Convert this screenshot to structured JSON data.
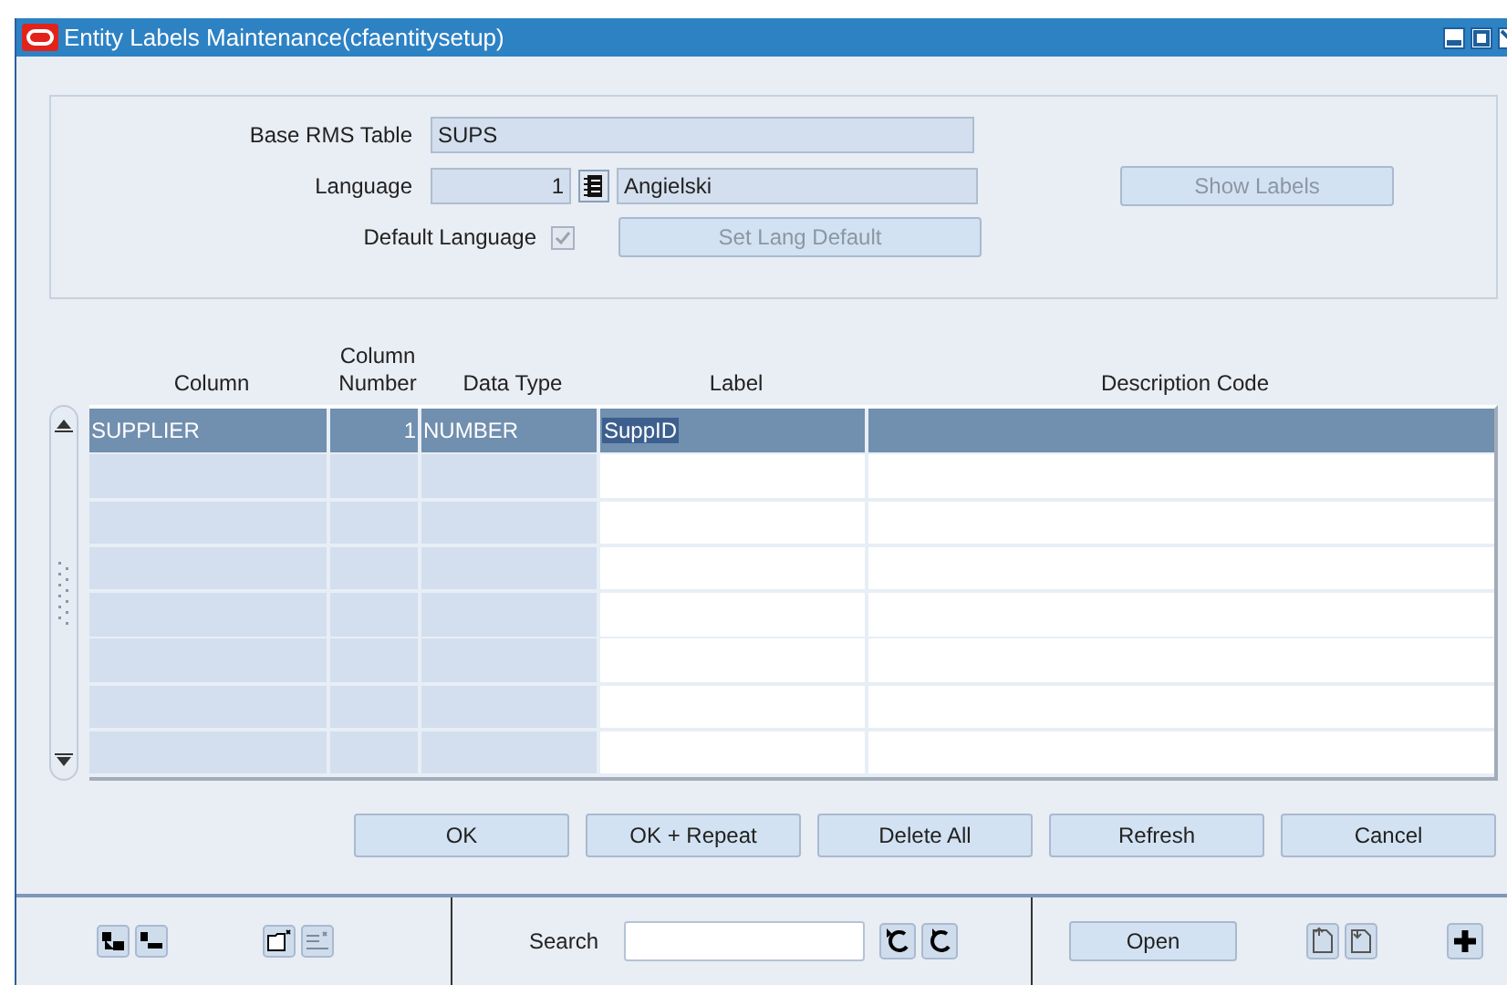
{
  "window": {
    "title": "Entity Labels Maintenance(cfaentitysetup)"
  },
  "form": {
    "base_table": {
      "label": "Base RMS Table",
      "value": "SUPS"
    },
    "language": {
      "label": "Language",
      "code": "1",
      "name": "Angielski"
    },
    "default_language": {
      "label": "Default Language",
      "checked": true,
      "disabled": true
    },
    "set_default_button": {
      "label": "Set Lang Default",
      "disabled": true
    },
    "show_labels_button": {
      "label": "Show Labels",
      "disabled": true
    }
  },
  "table": {
    "columns": [
      {
        "label": "Column"
      },
      {
        "label": "Column\nNumber"
      },
      {
        "label": "Data Type"
      },
      {
        "label": "Label"
      },
      {
        "label": "Description Code"
      }
    ],
    "rows": [
      {
        "column": "SUPPLIER",
        "column_number": "1",
        "data_type": "NUMBER",
        "label": "SuppID",
        "selected": true
      },
      {
        "selected": false
      },
      {
        "selected": false
      },
      {
        "selected": false
      },
      {
        "selected": false
      },
      {
        "selected": false
      },
      {
        "selected": false
      },
      {
        "selected": false
      }
    ]
  },
  "buttons": [
    "OK",
    "OK + Repeat",
    "Delete All",
    "Refresh",
    "Cancel"
  ],
  "toolbar": {
    "search_label": "Search",
    "open_button": "Open"
  }
}
